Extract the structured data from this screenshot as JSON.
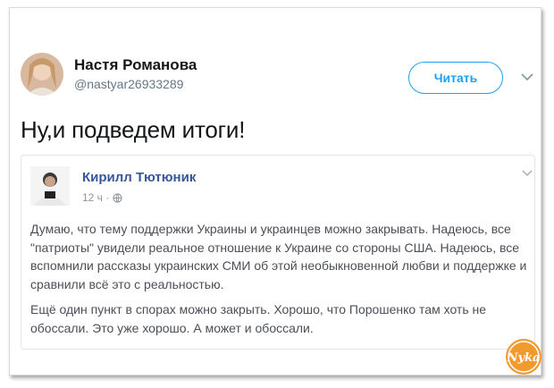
{
  "tweet": {
    "author_name": "Настя Романова",
    "author_handle": "@nastyar26933289",
    "follow_label": "Читать",
    "text": "Ну,и подведем итоги!"
  },
  "embedded_post": {
    "author_name": "Кирилл Тютюник",
    "time": "12 ч ·",
    "paragraph1": "Думаю, что тему поддержки Украины и украинцев можно закрывать. Надеюсь, все \"патриоты\" увидели реальное отношение к Украине со стороны США. Надеюсь, все вспомнили рассказы украинских СМИ об этой необыкновенной любви и поддержке и сравнили всё это с реальностью.",
    "paragraph2": "Ещё один пункт в спорах можно закрыть. Хорошо, что Порошенко там хоть не обоссали. Это уже хорошо. А может и обоссали."
  },
  "watermark": {
    "text": "Nyka"
  },
  "colors": {
    "accent": "#1da1f2",
    "fb_name": "#365899"
  },
  "icons": [
    "chevron-down-icon",
    "globe-icon"
  ]
}
